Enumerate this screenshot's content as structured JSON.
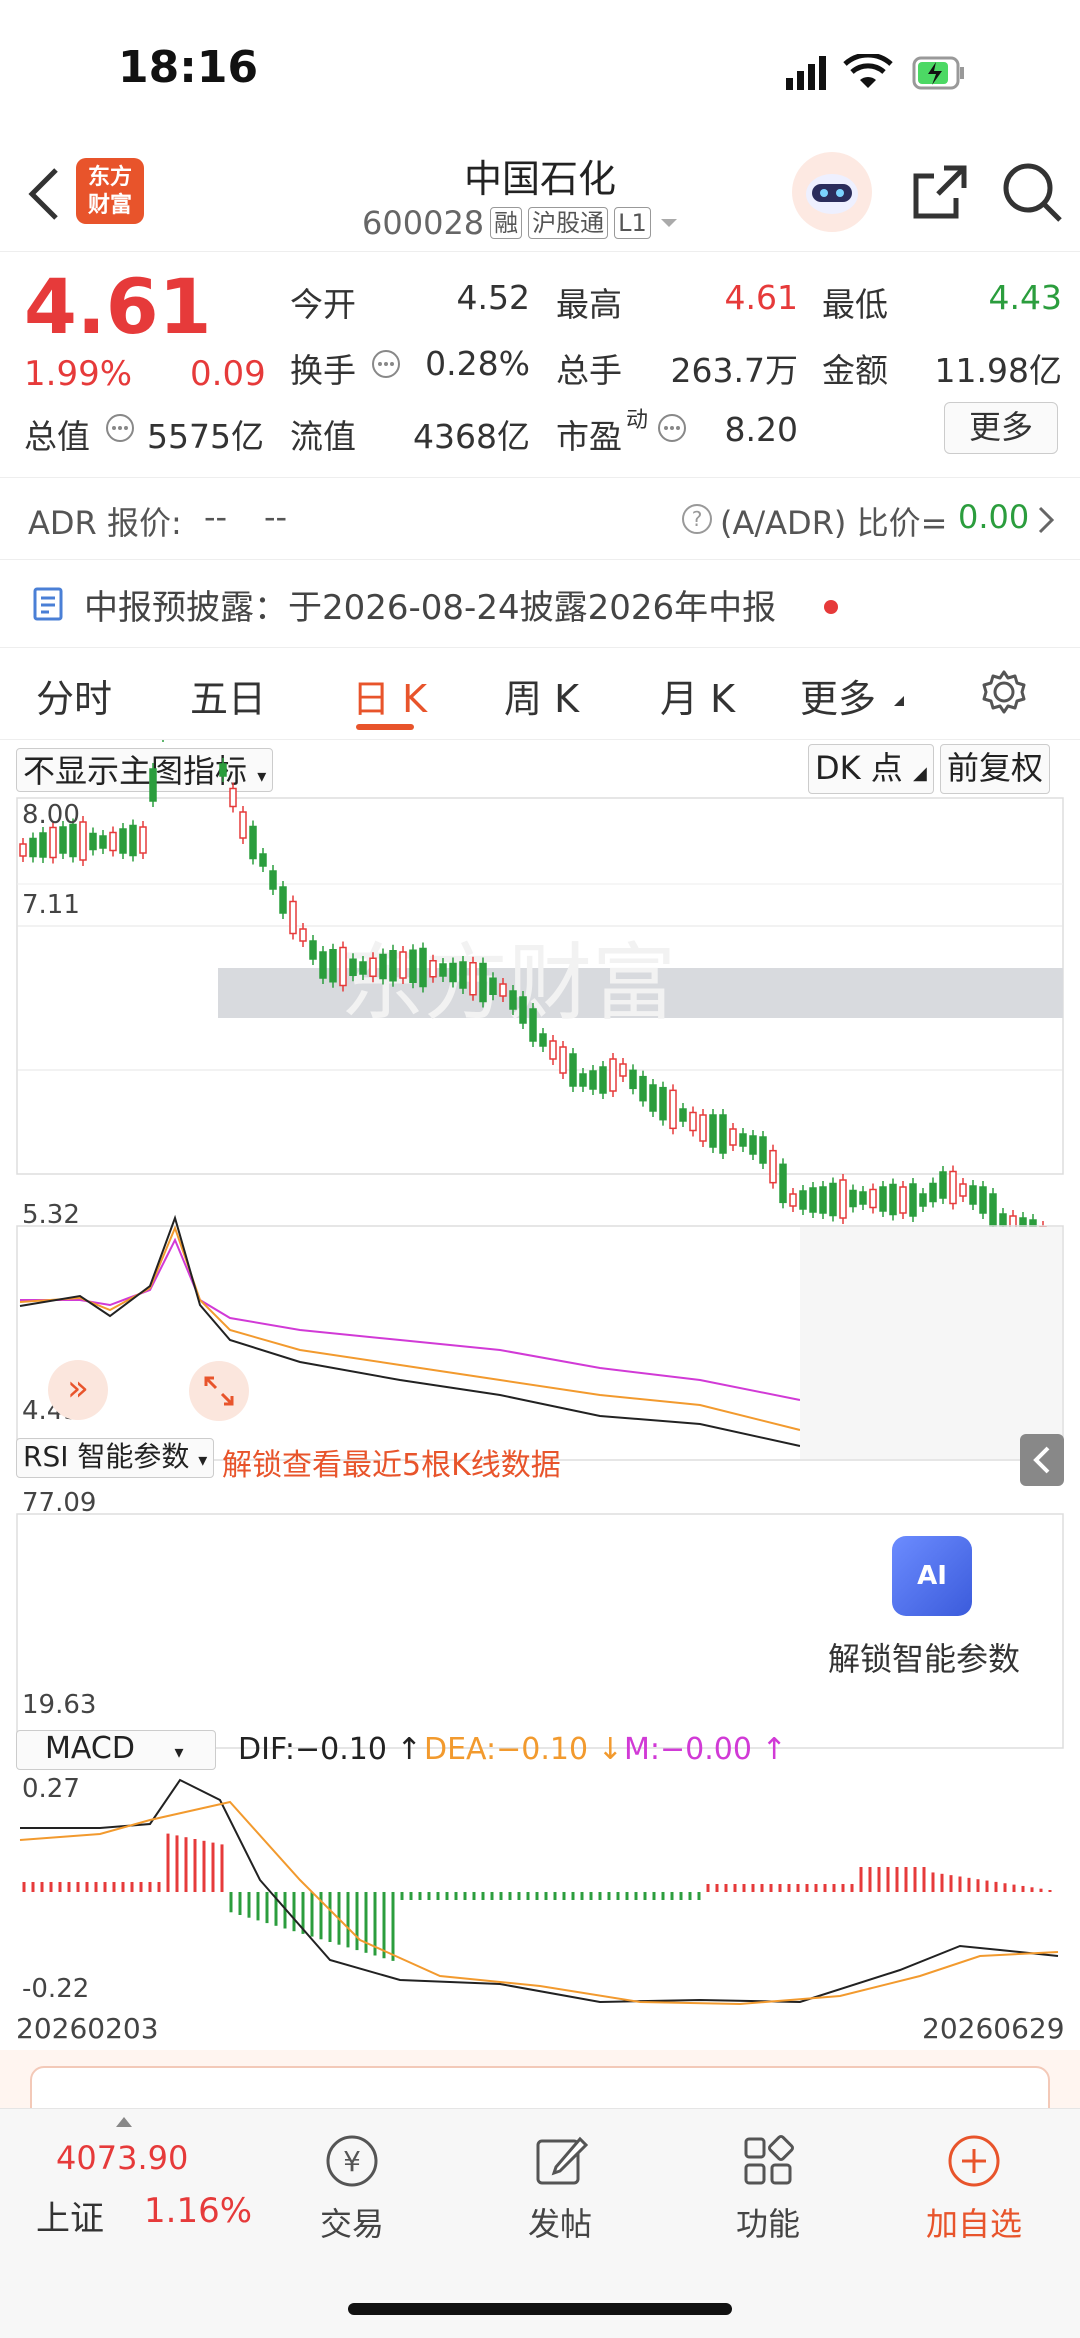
{
  "status": {
    "time": "18:16"
  },
  "header": {
    "logo_line1": "东方",
    "logo_line2": "财富",
    "name": "中国石化",
    "code": "600028",
    "tags": [
      "融",
      "沪股通",
      "L1"
    ]
  },
  "quote": {
    "price": "4.61",
    "pct": "1.99%",
    "change": "0.09",
    "open_label": "今开",
    "open": "4.52",
    "high_label": "最高",
    "high": "4.61",
    "low_label": "最低",
    "low": "4.43",
    "turnover_label": "换手",
    "turnover": "0.28%",
    "volume_label": "总手",
    "volume": "263.7万",
    "amount_label": "金额",
    "amount": "11.98亿",
    "mktcap_label": "总值",
    "mktcap": "5575亿",
    "float_label": "流值",
    "float": "4368亿",
    "pe_label": "市盈",
    "pe_sup": "动",
    "pe": "8.20",
    "more": "更多"
  },
  "adr": {
    "label": "ADR 报价:",
    "v1": "--",
    "v2": "--",
    "ratio_label": "(A/ADR) 比价=",
    "ratio": "0.00"
  },
  "notice": {
    "text": "中报预披露：于2026-08-24披露2026年中报"
  },
  "tabs": [
    "分时",
    "五日",
    "日 K",
    "周 K",
    "月 K",
    "更多"
  ],
  "kline": {
    "indicator_select": "不显示主图指标",
    "dk": "DK 点",
    "adjust": "前复权",
    "watermark": "东方财富",
    "y_labels": [
      "8.00",
      "7.11",
      "5.32",
      "4.43"
    ]
  },
  "rsi": {
    "select": "RSI 智能参数",
    "unlock": "解锁查看最近5根K线数据",
    "y_max": "77.09",
    "y_min": "19.63",
    "ai_badge": "AI",
    "ai_label": "解锁智能参数"
  },
  "macd": {
    "select": "MACD",
    "dif": "DIF:−0.10",
    "dea": "DEA:−0.10",
    "m": "M:−0.00",
    "y_max": "0.27",
    "y_min": "-0.22",
    "date_start": "20260203",
    "date_end": "20260629"
  },
  "bottom": {
    "index_value": "4073.90",
    "index_name": "上证",
    "index_pct": "1.16%",
    "nav": [
      "交易",
      "发帖",
      "功能",
      "加自选"
    ]
  },
  "colors": {
    "accent": "#e8542b",
    "up": "#e63a3a",
    "down": "#2b9d3d"
  }
}
